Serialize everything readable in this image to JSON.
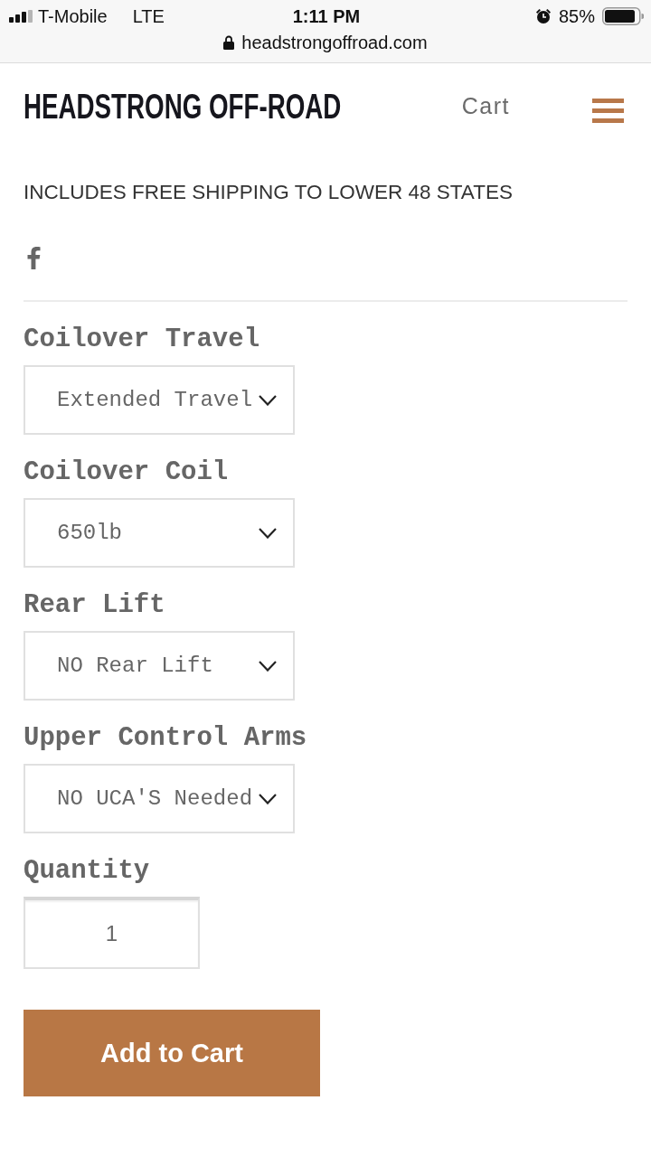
{
  "status_bar": {
    "carrier": "T-Mobile",
    "network": "LTE",
    "time": "1:11 PM",
    "battery": "85%"
  },
  "address_bar": {
    "url": "headstrongoffroad.com"
  },
  "header": {
    "logo": "HEADSTRONG OFF-ROAD",
    "cart": "Cart"
  },
  "shipping_note": "INCLUDES FREE SHIPPING TO LOWER 48 STATES",
  "options": [
    {
      "label": "Coilover Travel",
      "value": "Extended Travel"
    },
    {
      "label": "Coilover Coil",
      "value": "650lb"
    },
    {
      "label": "Rear Lift",
      "value": "NO Rear Lift"
    },
    {
      "label": "Upper Control Arms",
      "value": "NO UCA'S Needed"
    }
  ],
  "quantity": {
    "label": "Quantity",
    "value": "1"
  },
  "add_to_cart": "Add to Cart"
}
